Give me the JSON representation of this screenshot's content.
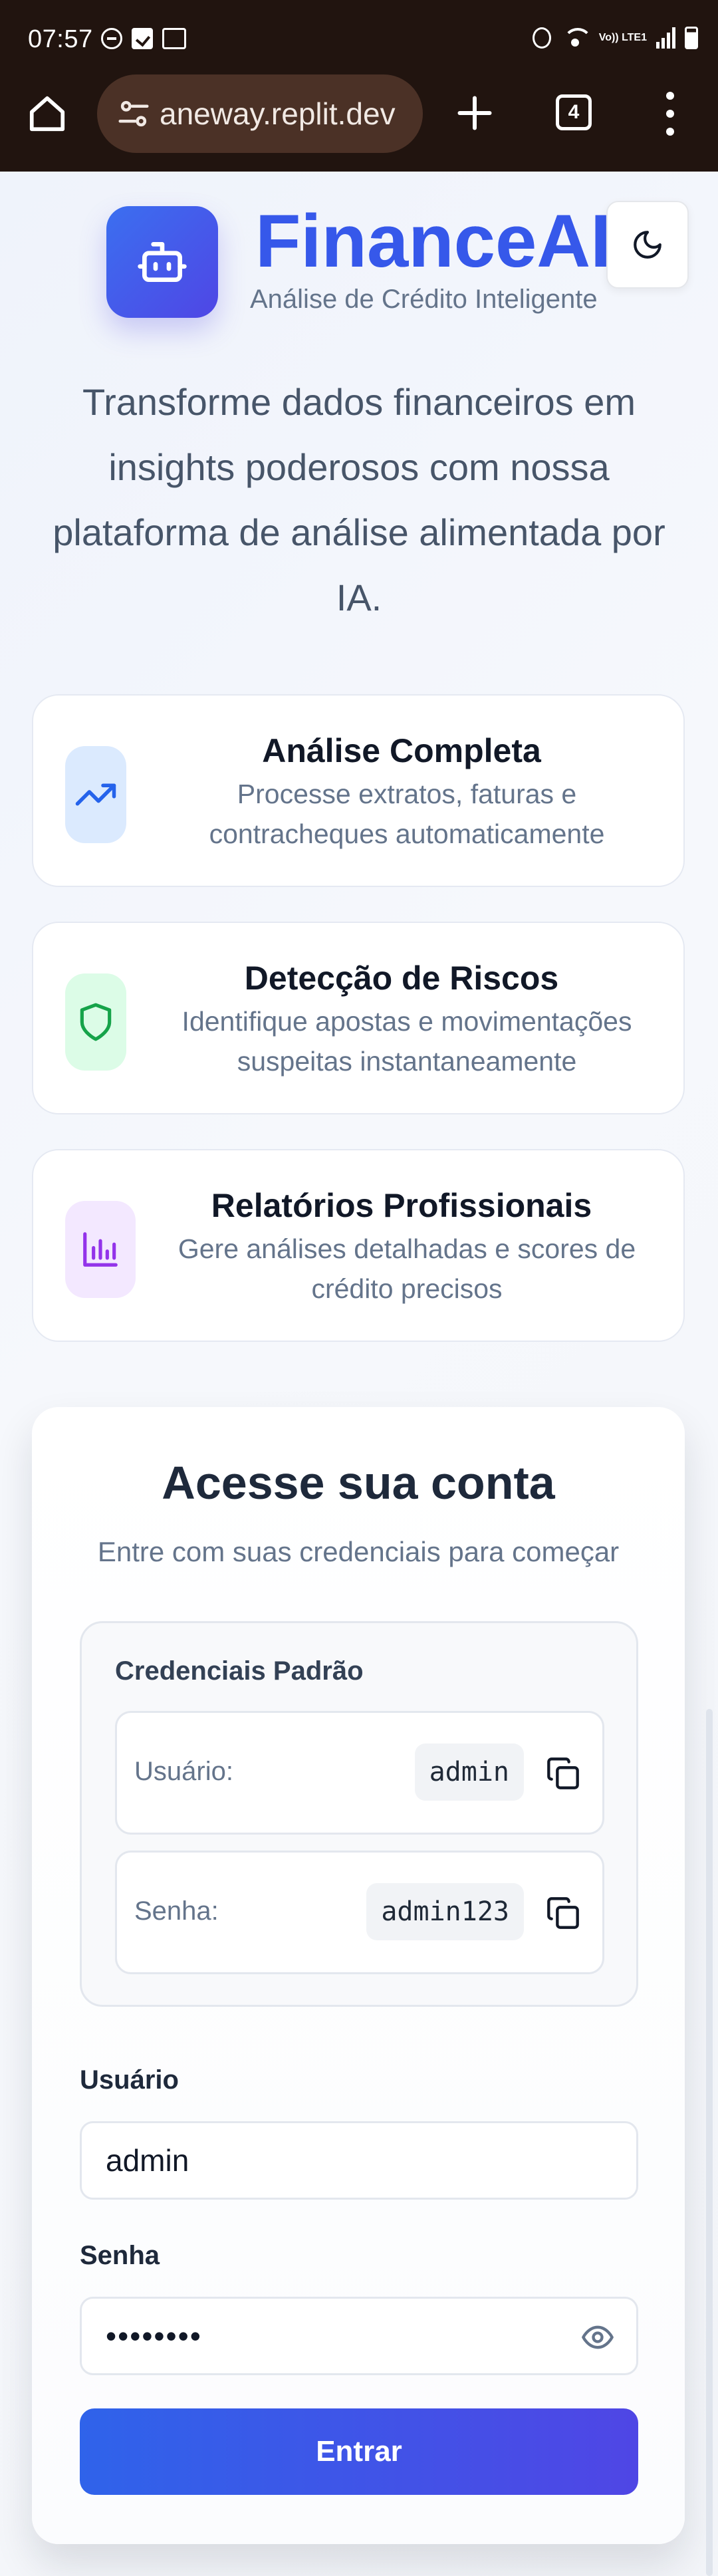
{
  "status_bar": {
    "time": "07:57",
    "network_label": "Vo)) LTE1"
  },
  "browser": {
    "url": "aneway.replit.dev",
    "tab_count": "4"
  },
  "header": {
    "brand": "FinanceAI",
    "tagline": "Análise de Crédito Inteligente",
    "hero": "Transforme dados financeiros em insights poderosos com nossa plataforma de análise alimentada por IA."
  },
  "features": [
    {
      "title": "Análise Completa",
      "description": "Processe extratos, faturas e contracheques automaticamente",
      "icon": "trending-up-icon",
      "color": "#2563eb",
      "bg": "#dbeafe"
    },
    {
      "title": "Detecção de Riscos",
      "description": "Identifique apostas e movimentações suspeitas instantaneamente",
      "icon": "shield-icon",
      "color": "#16a34a",
      "bg": "#dcfce7"
    },
    {
      "title": "Relatórios Profissionais",
      "description": "Gere análises detalhadas e scores de crédito precisos",
      "icon": "bar-chart-icon",
      "color": "#9333ea",
      "bg": "#f3e8ff"
    }
  ],
  "login": {
    "title": "Acesse sua conta",
    "subtitle": "Entre com suas credenciais para começar",
    "defaults": {
      "title": "Credenciais Padrão",
      "user_label": "Usuário:",
      "user_value": "admin",
      "pass_label": "Senha:",
      "pass_value": "admin123"
    },
    "username_label": "Usuário",
    "username_value": "admin",
    "password_label": "Senha",
    "password_value": "••••••••",
    "submit": "Entrar"
  },
  "colors": {
    "accent": "#4f46e5",
    "brand_blue": "#2f5ee8",
    "browser_bar": "#21140f"
  }
}
